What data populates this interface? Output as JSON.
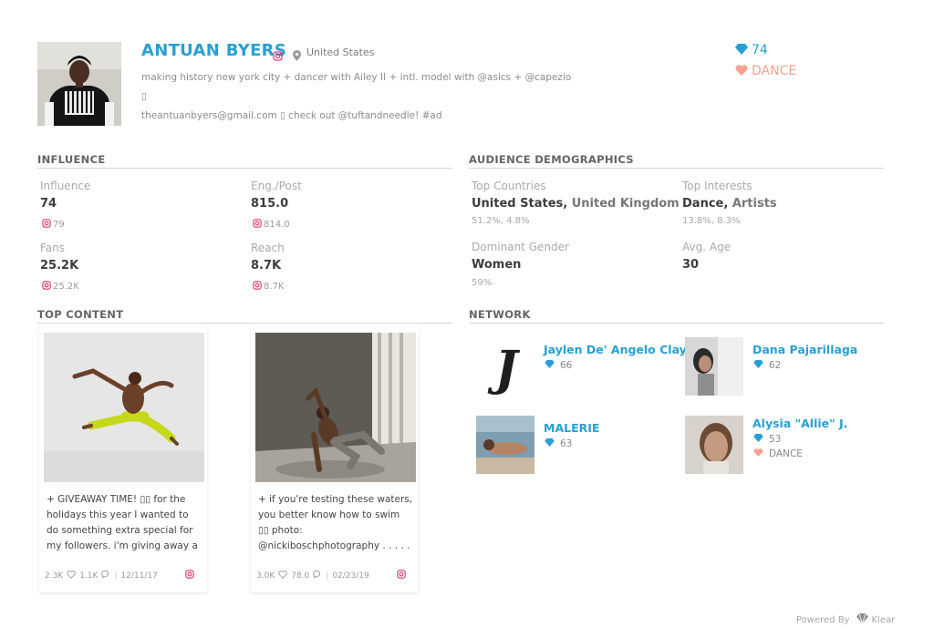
{
  "profile": {
    "name": "ANTUAN BYERS",
    "location": "United States",
    "bio_line1": "making history new york city + dancer with Ailey II + intl. model with @asics + @capezio ▯",
    "bio_line2": "theantuanbyers@gmail.com ▯ check out @tuftandneedle! #ad",
    "score": "74",
    "category": "DANCE"
  },
  "influence": {
    "title": "INFLUENCE",
    "influence_label": "Influence",
    "influence_value": "74",
    "influence_ig": "79",
    "eng_label": "Eng./Post",
    "eng_value": "815.0",
    "eng_ig": "814.0",
    "fans_label": "Fans",
    "fans_value": "25.2K",
    "fans_ig": "25.2K",
    "reach_label": "Reach",
    "reach_value": "8.7K",
    "reach_ig": "8.7K"
  },
  "demographics": {
    "title": "AUDIENCE DEMOGRAPHICS",
    "countries_label": "Top Countries",
    "country_1": "United States,",
    "country_2": "United Kingdom",
    "countries_pct": "51.2%, 4.8%",
    "interests_label": "Top Interests",
    "interest_1": "Dance,",
    "interest_2": "Artists",
    "interests_pct": "13.8%, 8.3%",
    "gender_label": "Dominant Gender",
    "gender_value": "Women",
    "gender_pct": "59%",
    "age_label": "Avg. Age",
    "age_value": "30"
  },
  "top_content": {
    "title": "TOP CONTENT",
    "posts": [
      {
        "caption": "+ GIVEAWAY TIME! ▯▯ for the holidays this year I wanted to do something extra special for my followers. i'm giving away a",
        "likes": "2.3K",
        "comments": "1.1K",
        "date": "12/11/17"
      },
      {
        "caption": "+ if you're testing these waters, you better know how to swim ▯▯ photo: @nickiboschphotography . . . . . .",
        "likes": "3.0K",
        "comments": "78.0",
        "date": "02/23/19"
      }
    ]
  },
  "network": {
    "title": "NETWORK",
    "people": [
      {
        "name": "Jaylen De' Angelo Clay",
        "score": "66"
      },
      {
        "name": "Dana Pajarillaga",
        "score": "62"
      },
      {
        "name": "MALERIE",
        "score": "63"
      },
      {
        "name": "Alysia \"Allie\" J.",
        "score": "53",
        "category": "DANCE"
      }
    ]
  },
  "footer": {
    "powered_by": "Powered By",
    "brand": "Klear"
  },
  "colors": {
    "accent_blue": "#2a9fd2",
    "category_salmon": "#f4a393",
    "instagram_pink": "#e1306c"
  },
  "icons": [
    "instagram-icon",
    "location-pin-icon",
    "diamond-icon",
    "heart-icon",
    "comment-icon",
    "klear-logo-icon"
  ]
}
